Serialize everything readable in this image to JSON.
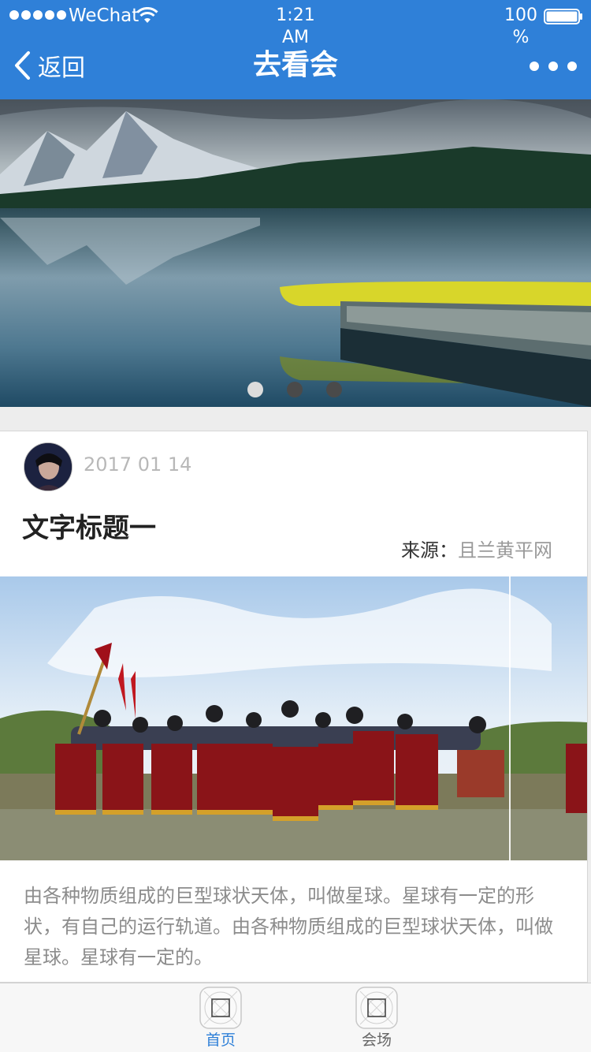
{
  "status_bar": {
    "carrier": "WeChat",
    "time_line1": "1:21",
    "time_line2": "AM",
    "battery_line1": "100",
    "battery_line2": "%",
    "battery_level": 1.0
  },
  "nav": {
    "back_label": "返回",
    "title": "去看会",
    "accent": "#2f80d8"
  },
  "banner": {
    "slide_count": 3,
    "active_slide": 1
  },
  "article": {
    "date": "2017 01 14",
    "title": "文字标题一",
    "source_label": "来源：",
    "source_value": "且兰黄平网",
    "body": "由各种物质组成的巨型球状天体，叫做星球。星球有一定的形状，有自己的运行轨道。由各种物质组成的巨型球状天体，叫做星球。星球有一定的。"
  },
  "tabbar": {
    "items": [
      {
        "label": "首页",
        "active": true,
        "icon": "tab-placeholder-icon"
      },
      {
        "label": "会场",
        "active": false,
        "icon": "tab-placeholder-icon"
      }
    ],
    "active_color": "#2f80d8"
  }
}
